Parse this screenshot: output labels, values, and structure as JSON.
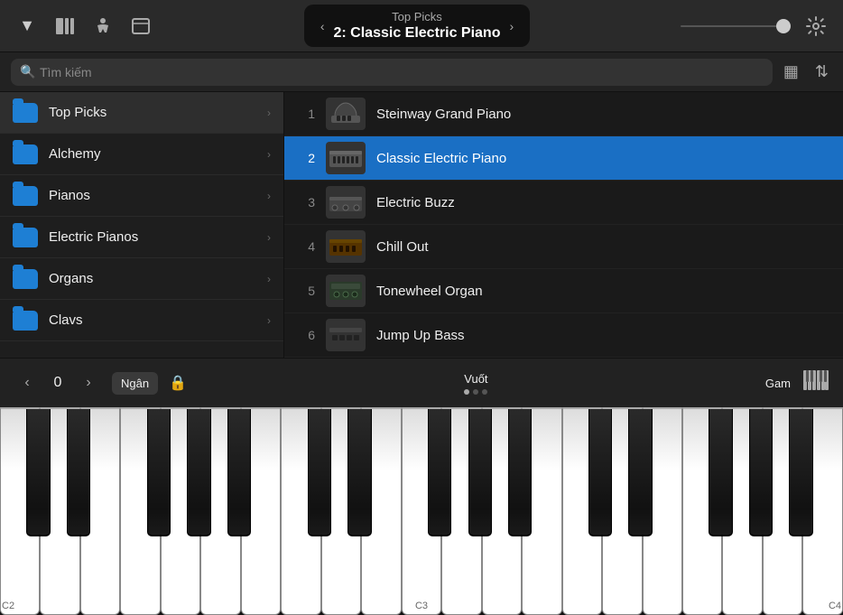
{
  "topbar": {
    "title": "Top Picks",
    "subtitle": "2: Classic Electric Piano",
    "icons": {
      "dropdown": "▼",
      "library": "📚",
      "figure": "🏃",
      "window": "⬜",
      "chevron_left": "‹",
      "chevron_right": "›",
      "settings": "⚙"
    }
  },
  "search": {
    "placeholder": "Tìm kiếm",
    "icon_grid": "▦",
    "icon_sort": "⇅"
  },
  "sidebar": {
    "items": [
      {
        "label": "Top Picks",
        "active": true
      },
      {
        "label": "Alchemy",
        "active": false
      },
      {
        "label": "Pianos",
        "active": false
      },
      {
        "label": "Electric Pianos",
        "active": false
      },
      {
        "label": "Organs",
        "active": false
      },
      {
        "label": "Clavs",
        "active": false
      }
    ]
  },
  "instruments": {
    "items": [
      {
        "num": "1",
        "name": "Steinway Grand Piano",
        "selected": false
      },
      {
        "num": "2",
        "name": "Classic Electric Piano",
        "selected": true
      },
      {
        "num": "3",
        "name": "Electric Buzz",
        "selected": false
      },
      {
        "num": "4",
        "name": "Chill Out",
        "selected": false
      },
      {
        "num": "5",
        "name": "Tonewheel Organ",
        "selected": false
      },
      {
        "num": "6",
        "name": "Jump Up Bass",
        "selected": false
      }
    ]
  },
  "toolbar": {
    "nav_left": "‹",
    "nav_right": "›",
    "octave": "0",
    "bank_label": "Ngân",
    "lock_icon": "🔒",
    "center_label": "Vuốt",
    "dots": [
      true,
      false,
      false
    ],
    "scale_label": "Gam",
    "piano_icon": "🎹"
  },
  "piano": {
    "bottom_labels": [
      "C2",
      "C3",
      "C4"
    ]
  }
}
